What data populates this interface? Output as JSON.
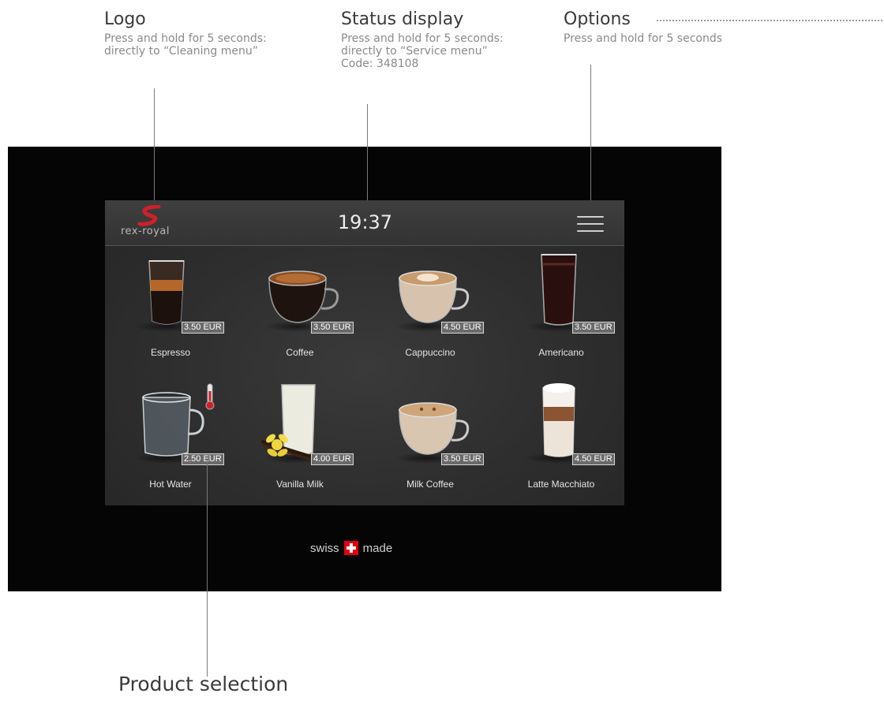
{
  "callouts": {
    "logo": {
      "title": "Logo",
      "desc1": "Press and hold for 5 seconds:",
      "desc2": "directly to “Cleaning menu”"
    },
    "status": {
      "title": "Status display",
      "desc1": "Press and hold for 5 seconds:",
      "desc2": "directly to “Service menu”",
      "desc3": "Code: 348108"
    },
    "options": {
      "title": "Options",
      "desc1": "Press and hold for 5 seconds"
    },
    "product": {
      "title": "Product selection"
    }
  },
  "screen": {
    "brand": "rex-royal",
    "time": "19:37",
    "menu_icon": "hamburger-menu-icon",
    "products": [
      {
        "name": "Espresso",
        "price": "3.50 EUR"
      },
      {
        "name": "Coffee",
        "price": "3.50 EUR"
      },
      {
        "name": "Cappuccino",
        "price": "4.50 EUR"
      },
      {
        "name": "Americano",
        "price": "3.50 EUR"
      },
      {
        "name": "Hot Water",
        "price": "2.50 EUR"
      },
      {
        "name": "Vanilla Milk",
        "price": "4.00 EUR"
      },
      {
        "name": "Milk Coffee",
        "price": "3.50 EUR"
      },
      {
        "name": "Latte Macchiato",
        "price": "4.50 EUR"
      }
    ]
  },
  "footer": {
    "left": "swiss",
    "right": "made"
  },
  "colors": {
    "brand_red": "#d0202a",
    "swiss_red": "#e3000f",
    "device_bg": "#050505",
    "screen_bg": "#333333"
  }
}
